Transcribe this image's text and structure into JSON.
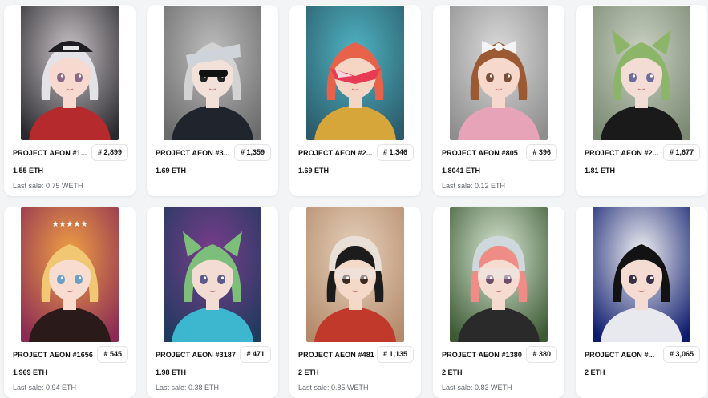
{
  "nfts": [
    {
      "name": "PROJECT AEON #1...",
      "rank": "# 2,899",
      "price": "1.55 ETH",
      "last_sale": "Last sale: 0.75 WETH",
      "art": {
        "bg": "#2a2a2e",
        "glow": "#c9c3c7",
        "hair": "#e3e2e6",
        "skin": "#f7d9cf",
        "eye": "#8a6a86",
        "outfit": "#b52a2c",
        "accent": "#1d1d22",
        "top": "cap"
      }
    },
    {
      "name": "PROJECT AEON #3...",
      "rank": "# 1,359",
      "price": "1.69 ETH",
      "last_sale": "",
      "art": {
        "bg": "#6b6b6b",
        "glow": "#bdbdbd",
        "hair": "#d3d3d3",
        "skin": "#f1e1d9",
        "eye": "#222222",
        "outfit": "#20242c",
        "accent": "#111111",
        "top": "visor"
      }
    },
    {
      "name": "PROJECT AEON #2...",
      "rank": "# 1,346",
      "price": "1.69 ETH",
      "last_sale": "",
      "art": {
        "bg": "#2b5b6a",
        "glow": "#4fb3c2",
        "hair": "#e8624a",
        "skin": "#f5d6c4",
        "eye": "#d8324a",
        "outfit": "#d6a63a",
        "accent": "#e73a55",
        "top": "mask"
      }
    },
    {
      "name": "PROJECT AEON #805",
      "rank": "# 396",
      "price": "1.8041 ETH",
      "last_sale": "Last sale: 0.12 ETH",
      "art": {
        "bg": "#8e8e8e",
        "glow": "#dadada",
        "hair": "#9c5a34",
        "skin": "#f6d9cc",
        "eye": "#7a4f3a",
        "outfit": "#e7a3b8",
        "accent": "#f4f4f4",
        "top": "bow"
      }
    },
    {
      "name": "PROJECT AEON #2...",
      "rank": "# 1,677",
      "price": "1.81 ETH",
      "last_sale": "",
      "art": {
        "bg": "#7a8a72",
        "glow": "#c9d0c2",
        "hair": "#8db56a",
        "skin": "#f3dcd3",
        "eye": "#6c6a9e",
        "outfit": "#1a1a1a",
        "accent": "#d8d8d8",
        "top": "ears"
      }
    },
    {
      "name": "PROJECT AEON #1656",
      "rank": "# 545",
      "price": "1.969 ETH",
      "last_sale": "Last sale: 0.94 ETH",
      "art": {
        "bg": "#8a2a55",
        "glow": "#f0a044",
        "hair": "#f1c774",
        "skin": "#f7dccf",
        "eye": "#6aa0c8",
        "outfit": "#2a1a1a",
        "accent": "#ffffff",
        "top": "stars"
      }
    },
    {
      "name": "PROJECT AEON #3187",
      "rank": "# 471",
      "price": "1.98 ETH",
      "last_sale": "Last sale: 0.38 ETH",
      "art": {
        "bg": "#203a5e",
        "glow": "#7a3d8c",
        "hair": "#7dbf7a",
        "skin": "#f3dcd3",
        "eye": "#5c5a8a",
        "outfit": "#3db7cf",
        "accent": "#e23b3b",
        "top": "ears"
      }
    },
    {
      "name": "PROJECT AEON #481",
      "rank": "# 1,135",
      "price": "2 ETH",
      "last_sale": "Last sale: 0.85 WETH",
      "art": {
        "bg": "#b48a6a",
        "glow": "#e6d2bd",
        "hair": "#1c1c1c",
        "skin": "#f4d9c9",
        "eye": "#3a2a22",
        "outfit": "#c0392b",
        "accent": "#e9e1d8",
        "top": "helmet"
      }
    },
    {
      "name": "PROJECT AEON #1380",
      "rank": "# 380",
      "price": "2 ETH",
      "last_sale": "Last sale: 0.83 WETH",
      "art": {
        "bg": "#3d5a34",
        "glow": "#d9e8d4",
        "hair": "#f08c86",
        "skin": "#f6dcd0",
        "eye": "#6b4e6a",
        "outfit": "#2a2a2a",
        "accent": "#cfd8dc",
        "top": "helmet"
      }
    },
    {
      "name": "PROJECT AEON #...",
      "rank": "# 3,065",
      "price": "2 ETH",
      "last_sale": "",
      "art": {
        "bg": "#0d1b6e",
        "glow": "#f2f2f2",
        "hair": "#121212",
        "skin": "#f4dcd2",
        "eye": "#3a2f47",
        "outfit": "#e8e8ef",
        "accent": "#1a2a8a",
        "top": "none"
      }
    }
  ]
}
